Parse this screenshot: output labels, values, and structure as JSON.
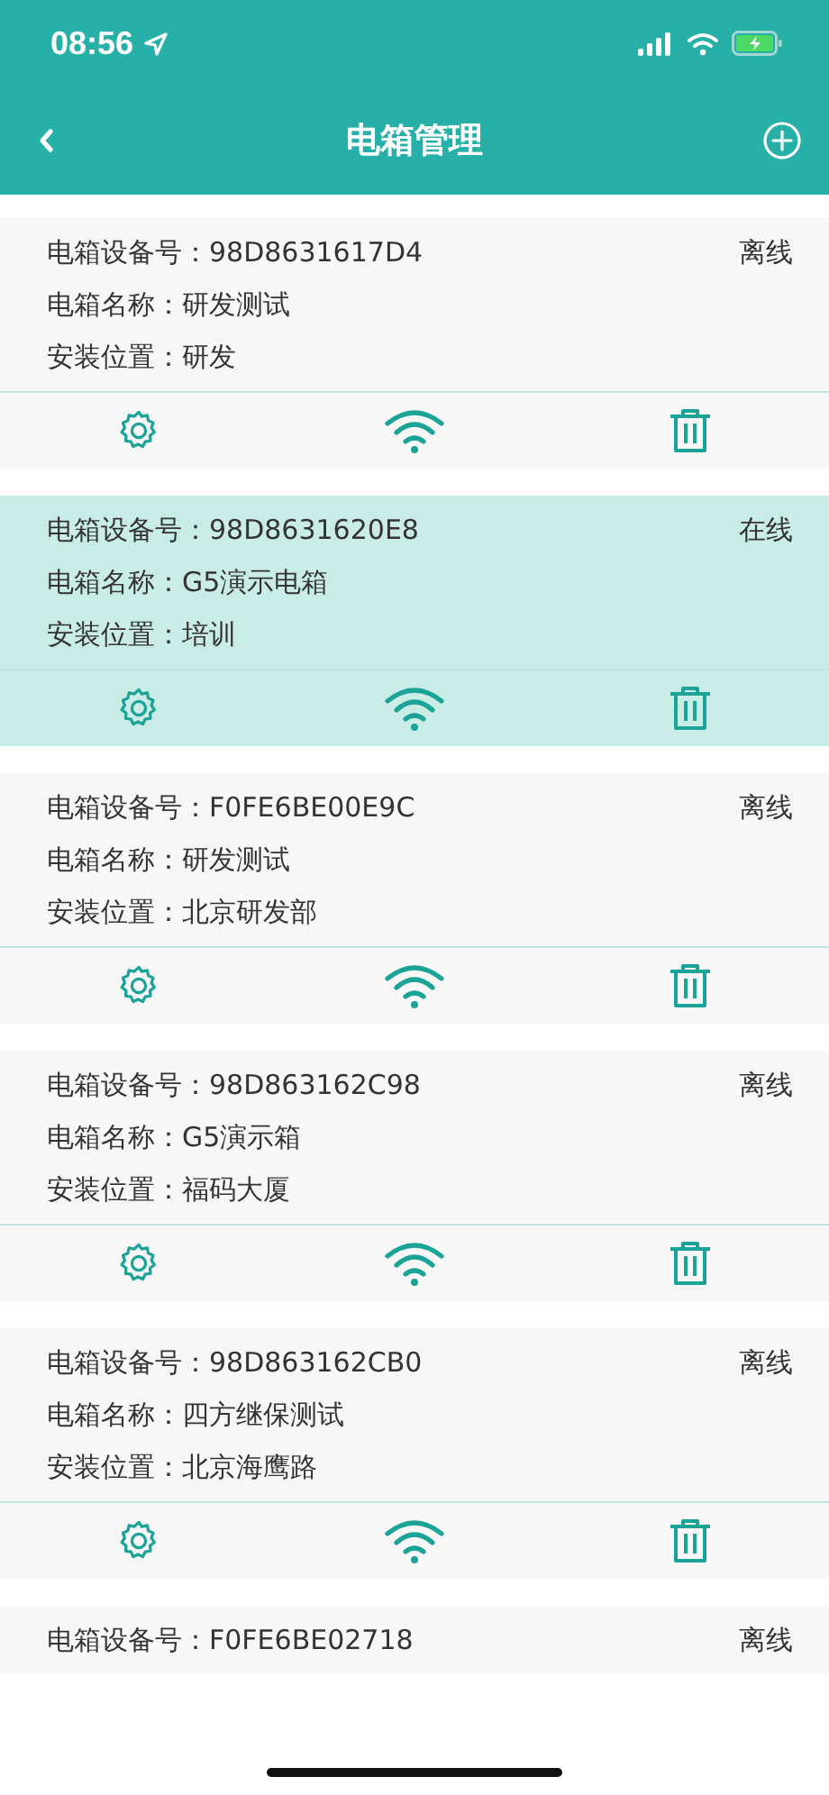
{
  "status_bar": {
    "time": "08:56"
  },
  "nav": {
    "title": "电箱管理"
  },
  "cards": [
    {
      "kind": "full",
      "selected": false,
      "id_line": "电箱设备号：98D8631617D4",
      "status": "离线",
      "name_line": "电箱名称：研发测试",
      "location_line": "安装位置：研发"
    },
    {
      "kind": "full",
      "selected": true,
      "id_line": "电箱设备号：98D8631620E8",
      "status": "在线",
      "name_line": "电箱名称：G5演示电箱",
      "location_line": "安装位置：培训"
    },
    {
      "kind": "full",
      "selected": false,
      "id_line": "电箱设备号：F0FE6BE00E9C",
      "status": "离线",
      "name_line": "电箱名称：研发测试",
      "location_line": "安装位置：北京研发部"
    },
    {
      "kind": "full",
      "selected": false,
      "id_line": "电箱设备号：98D863162C98",
      "status": "离线",
      "name_line": "电箱名称：G5演示箱",
      "location_line": "安装位置：福码大厦"
    },
    {
      "kind": "full",
      "selected": false,
      "id_line": "电箱设备号：98D863162CB0",
      "status": "离线",
      "name_line": "电箱名称：四方继保测试",
      "location_line": "安装位置：北京海鹰路"
    },
    {
      "kind": "partial",
      "selected": false,
      "id_line": "电箱设备号：F0FE6BE02718",
      "status": "离线"
    }
  ]
}
